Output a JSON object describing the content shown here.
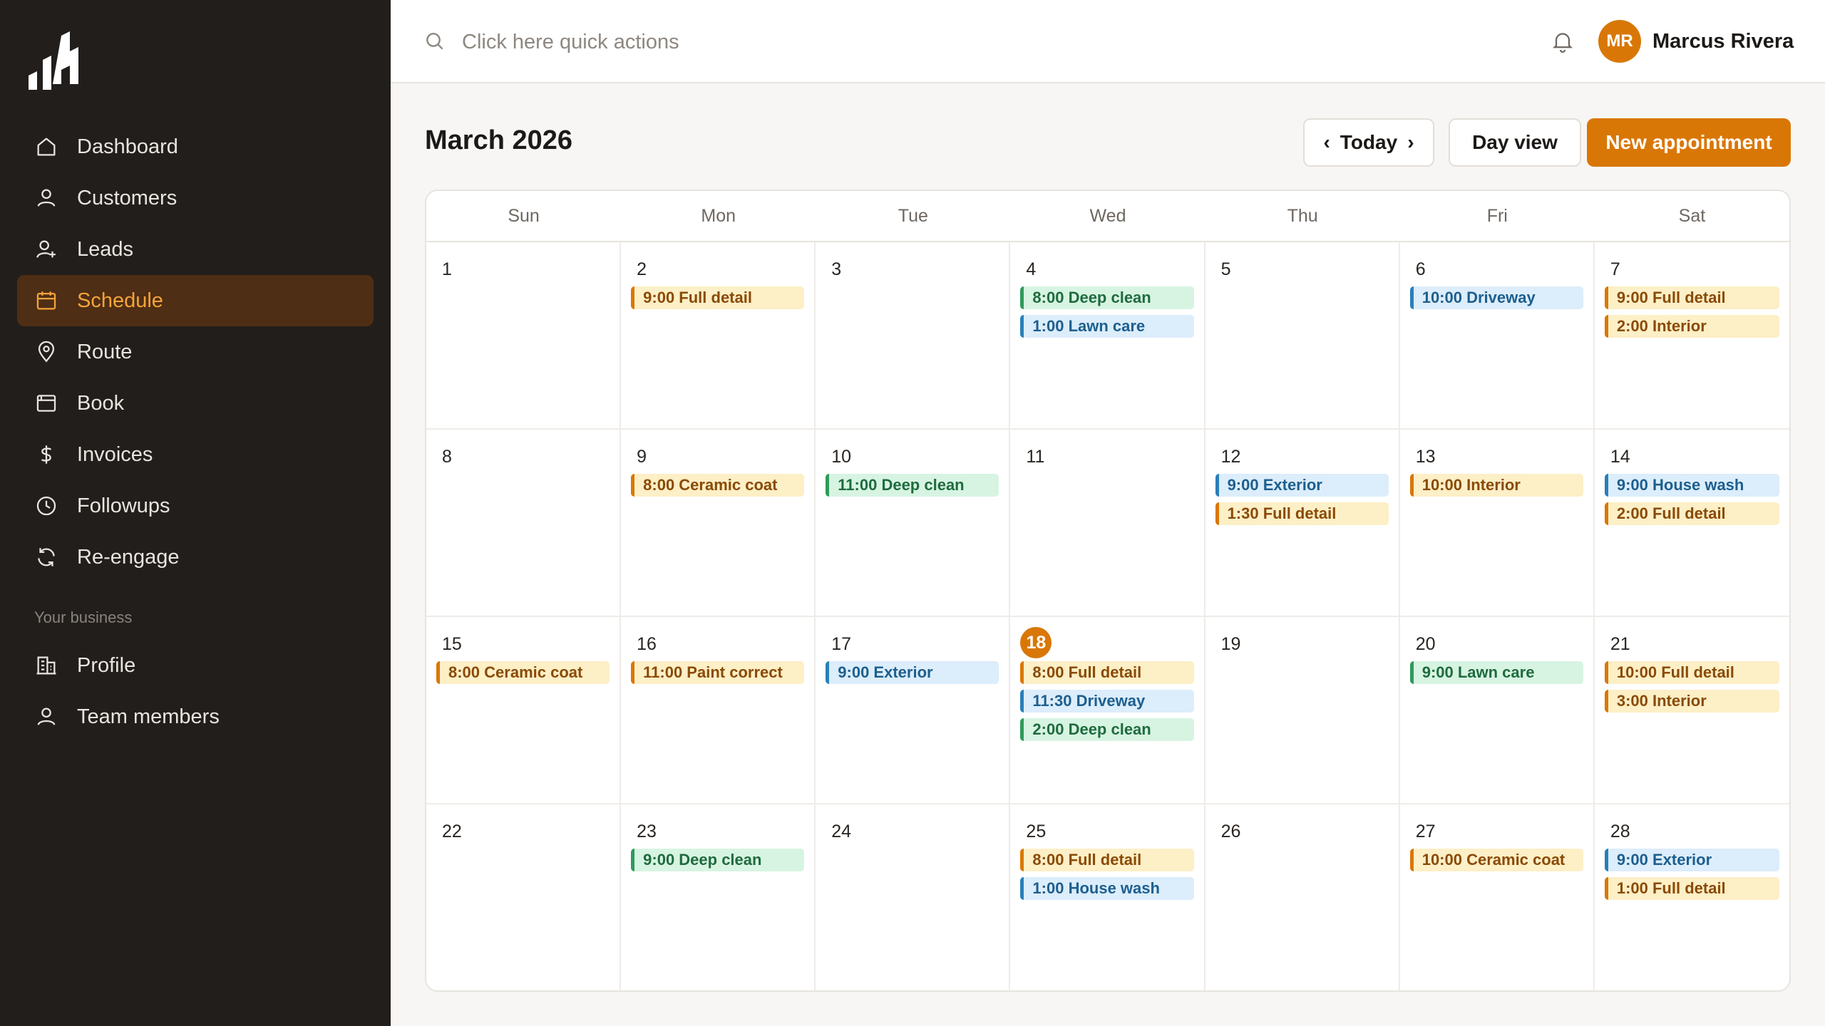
{
  "app": {
    "colors": {
      "accent": "#d97706",
      "sidebar_bg": "#221e1b",
      "orange_event": "#d97706",
      "blue_event": "#2a7fb8",
      "green_event": "#2e9a5b"
    }
  },
  "sidebar": {
    "items": [
      {
        "label": "Dashboard",
        "icon": "home-icon"
      },
      {
        "label": "Customers",
        "icon": "user-icon"
      },
      {
        "label": "Leads",
        "icon": "user-plus-icon"
      },
      {
        "label": "Schedule",
        "icon": "calendar-icon",
        "active": true
      },
      {
        "label": "Route",
        "icon": "map-pin-icon"
      },
      {
        "label": "Book",
        "icon": "browser-icon"
      },
      {
        "label": "Invoices",
        "icon": "dollar-icon"
      },
      {
        "label": "Followups",
        "icon": "clock-icon"
      },
      {
        "label": "Re-engage",
        "icon": "refresh-icon"
      }
    ],
    "section_label": "Your business",
    "business_items": [
      {
        "label": "Profile",
        "icon": "building-icon"
      },
      {
        "label": "Team members",
        "icon": "user-icon"
      }
    ]
  },
  "topbar": {
    "search_placeholder": "Click here quick actions",
    "user": {
      "initials": "MR",
      "name": "Marcus Rivera"
    }
  },
  "header": {
    "month_title": "March 2026",
    "today_label": "Today",
    "day_view_label": "Day view",
    "new_appointment_label": "New appointment"
  },
  "calendar": {
    "days_of_week": [
      "Sun",
      "Mon",
      "Tue",
      "Wed",
      "Thu",
      "Fri",
      "Sat"
    ],
    "today": "18",
    "cells": [
      {
        "day": "1",
        "events": []
      },
      {
        "day": "2",
        "events": [
          {
            "text": "9:00 Full detail",
            "color": "orange"
          }
        ]
      },
      {
        "day": "3",
        "events": []
      },
      {
        "day": "4",
        "events": [
          {
            "text": "8:00 Deep clean",
            "color": "green"
          },
          {
            "text": "1:00 Lawn care",
            "color": "blue"
          }
        ]
      },
      {
        "day": "5",
        "events": []
      },
      {
        "day": "6",
        "events": [
          {
            "text": "10:00 Driveway",
            "color": "blue"
          }
        ]
      },
      {
        "day": "7",
        "events": [
          {
            "text": "9:00 Full detail",
            "color": "orange"
          },
          {
            "text": "2:00 Interior",
            "color": "orange"
          }
        ]
      },
      {
        "day": "8",
        "events": []
      },
      {
        "day": "9",
        "events": [
          {
            "text": "8:00 Ceramic coat",
            "color": "orange"
          }
        ]
      },
      {
        "day": "10",
        "events": [
          {
            "text": "11:00 Deep clean",
            "color": "green"
          }
        ]
      },
      {
        "day": "11",
        "events": []
      },
      {
        "day": "12",
        "events": [
          {
            "text": "9:00 Exterior",
            "color": "blue"
          },
          {
            "text": "1:30 Full detail",
            "color": "orange"
          }
        ]
      },
      {
        "day": "13",
        "events": [
          {
            "text": "10:00 Interior",
            "color": "orange"
          }
        ]
      },
      {
        "day": "14",
        "events": [
          {
            "text": "9:00 House wash",
            "color": "blue"
          },
          {
            "text": "2:00 Full detail",
            "color": "orange"
          }
        ]
      },
      {
        "day": "15",
        "events": [
          {
            "text": "8:00 Ceramic coat",
            "color": "orange"
          }
        ]
      },
      {
        "day": "16",
        "events": [
          {
            "text": "11:00 Paint correct",
            "color": "orange"
          }
        ]
      },
      {
        "day": "17",
        "events": [
          {
            "text": "9:00 Exterior",
            "color": "blue"
          }
        ]
      },
      {
        "day": "18",
        "events": [
          {
            "text": "8:00 Full detail",
            "color": "orange"
          },
          {
            "text": "11:30 Driveway",
            "color": "blue"
          },
          {
            "text": "2:00 Deep clean",
            "color": "green"
          }
        ]
      },
      {
        "day": "19",
        "events": []
      },
      {
        "day": "20",
        "events": [
          {
            "text": "9:00 Lawn care",
            "color": "green"
          }
        ]
      },
      {
        "day": "21",
        "events": [
          {
            "text": "10:00 Full detail",
            "color": "orange"
          },
          {
            "text": "3:00 Interior",
            "color": "orange"
          }
        ]
      },
      {
        "day": "22",
        "events": []
      },
      {
        "day": "23",
        "events": [
          {
            "text": "9:00 Deep clean",
            "color": "green"
          }
        ]
      },
      {
        "day": "24",
        "events": []
      },
      {
        "day": "25",
        "events": [
          {
            "text": "8:00 Full detail",
            "color": "orange"
          },
          {
            "text": "1:00 House wash",
            "color": "blue"
          }
        ]
      },
      {
        "day": "26",
        "events": []
      },
      {
        "day": "27",
        "events": [
          {
            "text": "10:00 Ceramic coat",
            "color": "orange"
          }
        ]
      },
      {
        "day": "28",
        "events": [
          {
            "text": "9:00 Exterior",
            "color": "blue"
          },
          {
            "text": "1:00 Full detail",
            "color": "orange"
          }
        ]
      }
    ]
  }
}
